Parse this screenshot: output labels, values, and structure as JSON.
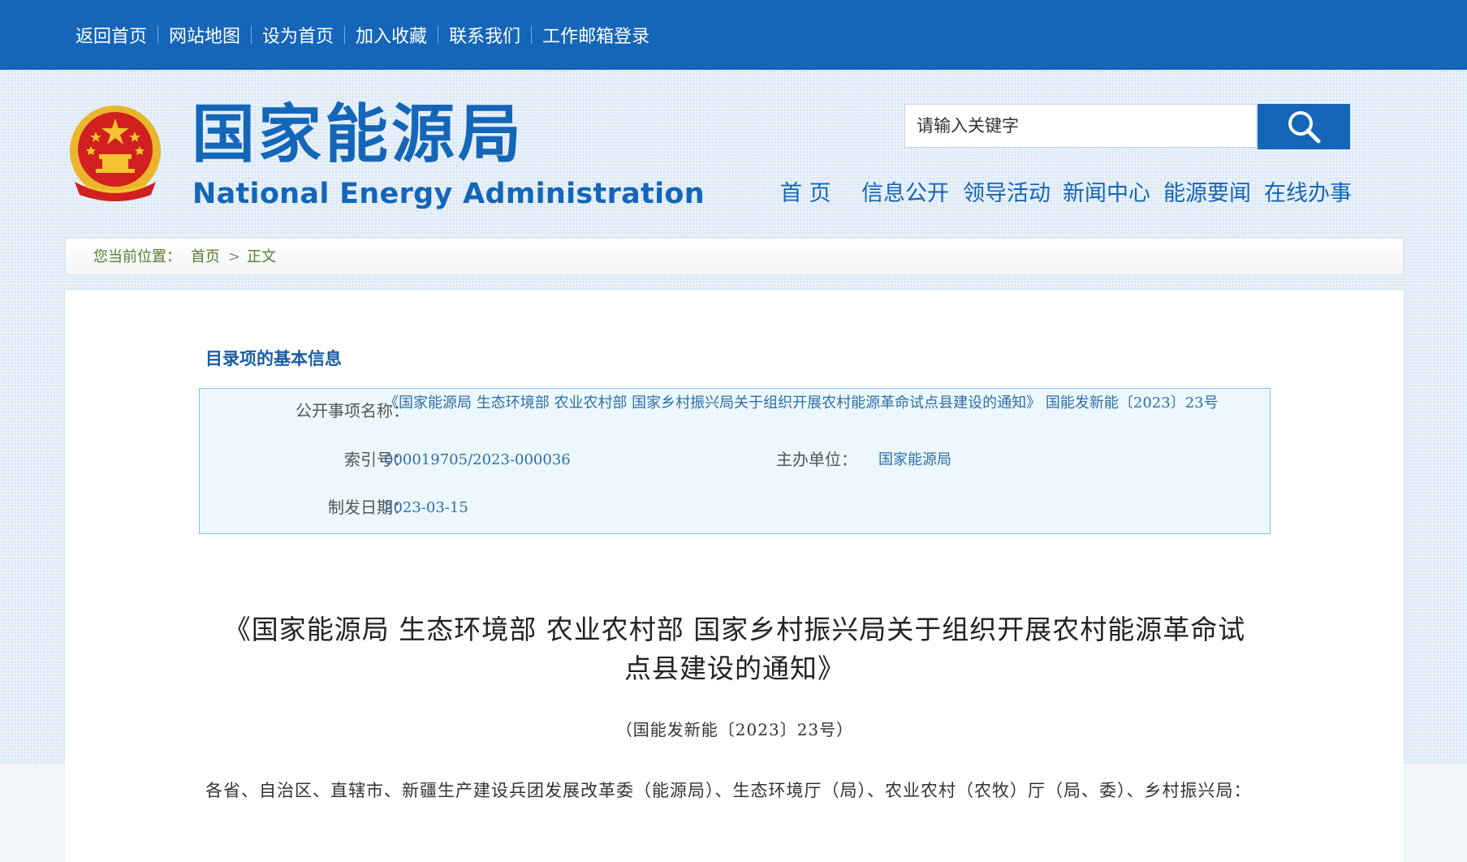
{
  "topbar": {
    "links": [
      "返回首页",
      "网站地图",
      "设为首页",
      "加入收藏",
      "联系我们",
      "工作邮箱登录"
    ]
  },
  "header": {
    "emblem_icon": "national-emblem-icon",
    "title_cn": "国家能源局",
    "title_en": "National Energy Administration",
    "search_placeholder": "请输入关键字",
    "search_icon": "magnifier-icon",
    "nav": [
      "首 页",
      "信息公开",
      "领导活动",
      "新闻中心",
      "能源要闻",
      "在线办事"
    ]
  },
  "breadcrumb": {
    "prefix": "您当前位置：",
    "home": "首页",
    "separator": ">",
    "current": "正文"
  },
  "info": {
    "heading": "目录项的基本信息",
    "name_label": "公开事项名称：",
    "name_value": "《国家能源局 生态环境部 农业农村部 国家乡村振兴局关于组织开展农村能源革命试点县建设的通知》 国能发新能〔2023〕23号",
    "index_label": "索引号：",
    "index_value": "000019705/2023-000036",
    "org_label": "主办单位：",
    "org_value": "国家能源局",
    "date_label": "制发日期：",
    "date_value": "2023-03-15"
  },
  "document": {
    "title": "《国家能源局 生态环境部 农业农村部 国家乡村振兴局关于组织开展农村能源革命试点县建设的通知》",
    "number": "（国能发新能〔2023〕23号）",
    "body": "各省、自治区、直辖市、新疆生产建设兵团发展改革委（能源局）、生态环境厅（局）、农业农村（农牧）厅（局、委）、乡村振兴局："
  },
  "colors": {
    "brand_blue": "#1565b9",
    "breadcrumb_green": "#5b7a2e",
    "info_value_blue": "#2d6ea8"
  }
}
